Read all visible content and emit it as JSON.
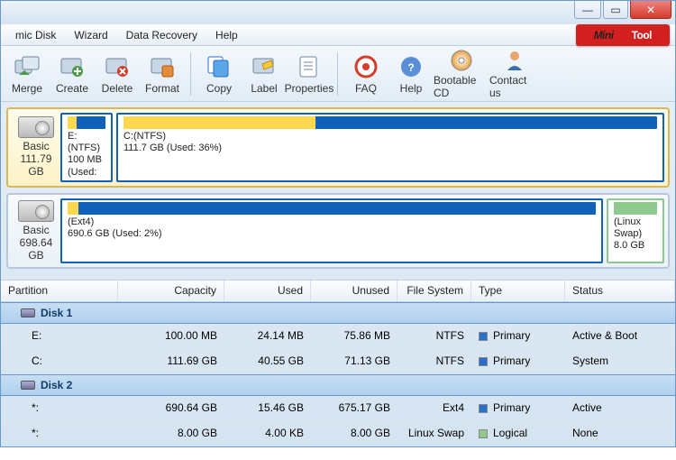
{
  "titlebar": {
    "minimize": "—",
    "maximize": "▭",
    "close": "✕"
  },
  "menu": {
    "dynamic_disk": "mic Disk",
    "wizard": "Wizard",
    "data_recovery": "Data Recovery",
    "help": "Help"
  },
  "logo": {
    "mini": "Mini",
    "tool": "Tool"
  },
  "toolbar": {
    "merge": "Merge",
    "create": "Create",
    "delete": "Delete",
    "format": "Format",
    "copy": "Copy",
    "label": "Label",
    "properties": "Properties",
    "faq": "FAQ",
    "help": "Help",
    "bootable_cd": "Bootable CD",
    "contact": "Contact us"
  },
  "disks": [
    {
      "name": "Basic",
      "size": "111.79 GB",
      "selected": true,
      "partitions": [
        {
          "label": "E:(NTFS)",
          "info": "100 MB (Used:",
          "width": 58,
          "used_pct": 24,
          "class": "ntfs"
        },
        {
          "label": "C:(NTFS)",
          "info": "111.7 GB (Used: 36%)",
          "width": 1,
          "used_pct": 36,
          "class": "ntfs",
          "flex": true
        }
      ]
    },
    {
      "name": "Basic",
      "size": "698.64 GB",
      "selected": false,
      "partitions": [
        {
          "label": "(Ext4)",
          "info": "690.6 GB (Used: 2%)",
          "used_pct": 2,
          "class": "ntfs",
          "flex": true
        },
        {
          "label": "(Linux Swap)",
          "info": "8.0 GB",
          "width": 64,
          "used_pct": 0,
          "class": "swap"
        }
      ]
    }
  ],
  "columns": {
    "partition": "Partition",
    "capacity": "Capacity",
    "used": "Used",
    "unused": "Unused",
    "file_system": "File System",
    "type": "Type",
    "status": "Status"
  },
  "groups": [
    {
      "title": "Disk 1",
      "rows": [
        {
          "partition": "E:",
          "capacity": "100.00 MB",
          "used": "24.14 MB",
          "unused": "75.86 MB",
          "fs": "NTFS",
          "type": "Primary",
          "type_class": "primary",
          "status": "Active & Boot"
        },
        {
          "partition": "C:",
          "capacity": "111.69 GB",
          "used": "40.55 GB",
          "unused": "71.13 GB",
          "fs": "NTFS",
          "type": "Primary",
          "type_class": "primary",
          "status": "System"
        }
      ]
    },
    {
      "title": "Disk 2",
      "rows": [
        {
          "partition": "*:",
          "capacity": "690.64 GB",
          "used": "15.46 GB",
          "unused": "675.17 GB",
          "fs": "Ext4",
          "type": "Primary",
          "type_class": "primary",
          "status": "Active"
        },
        {
          "partition": "*:",
          "capacity": "8.00 GB",
          "used": "4.00 KB",
          "unused": "8.00 GB",
          "fs": "Linux Swap",
          "type": "Logical",
          "type_class": "logical",
          "status": "None"
        }
      ]
    }
  ]
}
